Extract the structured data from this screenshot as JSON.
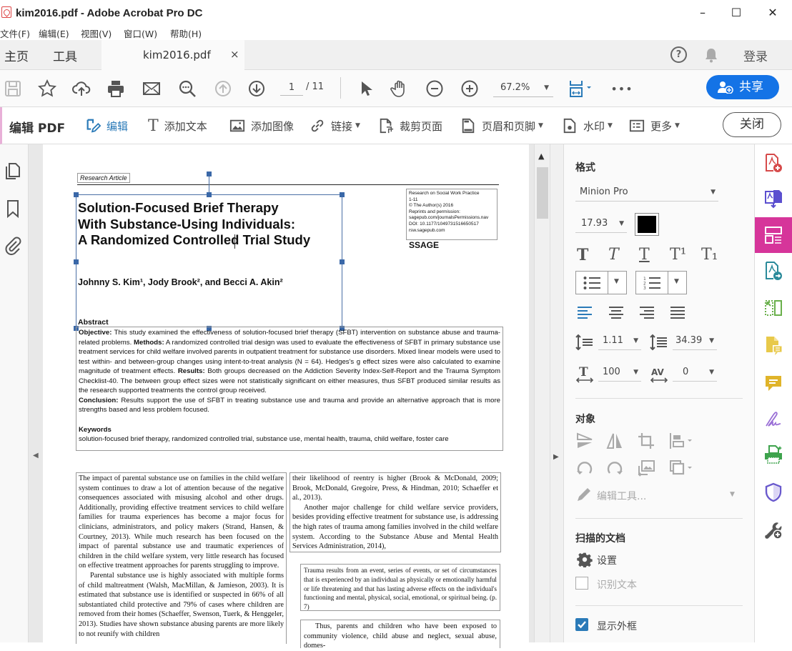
{
  "window": {
    "title": "kim2016.pdf - Adobe Acrobat Pro DC",
    "controls": {
      "minimize": "–",
      "maximize": "☐",
      "close": "✕"
    }
  },
  "menu": [
    "文件(F)",
    "编辑(E)",
    "视图(V)",
    "窗口(W)",
    "帮助(H)"
  ],
  "tabs": {
    "home": "主页",
    "tools": "工具",
    "document": "kim2016.pdf",
    "close_tab": "×",
    "help": "?",
    "login": "登录"
  },
  "toolbar": {
    "icons": [
      "save-icon",
      "star-icon",
      "cloud-upload-icon",
      "print-icon",
      "email-icon",
      "find-icon",
      "page-up-icon",
      "page-down-icon",
      "select-cursor-icon",
      "hand-icon",
      "zoom-out-icon",
      "zoom-in-icon",
      "fit-page-icon",
      "more-icon"
    ],
    "page_current": "1",
    "page_total": "/ 11",
    "zoom": "67.2%",
    "more": "•••",
    "share_label": "共享"
  },
  "edit_toolbar": {
    "title": "编辑 PDF",
    "edit": "编辑",
    "add_text": "添加文本",
    "add_image": "添加图像",
    "link": "链接",
    "crop": "裁剪页面",
    "header_footer": "页眉和页脚",
    "watermark": "水印",
    "more": "更多",
    "close": "关闭",
    "active_color": "#2a7ab8"
  },
  "format_panel": {
    "heading": "格式",
    "font": "Minion Pro",
    "font_size": "17.93",
    "text_color": "#000000",
    "style_buttons": [
      "T",
      "T",
      "T",
      "T¹",
      "T₁"
    ],
    "line_spacing": "1.11",
    "paragraph_spacing": "34.39",
    "horizontal_scale": "100",
    "char_spacing": "0",
    "objects_heading": "对象",
    "edit_tools": "编辑工具...",
    "scanned_heading": "扫描的文档",
    "settings": "设置",
    "recognize_text": "识别文本",
    "recognize_checked": false,
    "show_bounding": "显示外框",
    "show_bounding_checked": true
  },
  "right_rail": {
    "tools": [
      "create-pdf",
      "export-pdf",
      "edit-pdf",
      "combine-files",
      "organize-pages",
      "comment-file",
      "comment",
      "fill-sign",
      "scan",
      "protect",
      "more-tools"
    ],
    "active": "edit-pdf",
    "active_color": "#d6359a"
  },
  "document": {
    "label": "Research Article",
    "title_lines": [
      "Solution-Focused Brief Therapy",
      "With Substance-Using Individuals:",
      "A Randomized Controlled Trial Study"
    ],
    "authors": "Johnny S. Kim¹, Jody Brook², and Becci A. Akin²",
    "info_box": [
      "Research on Social Work Practice",
      "1-11",
      "© The Author(s) 2016",
      "Reprints and permission:",
      "sagepub.com/journalsPermissions.nav",
      "DOI: 10.1177/1049731516650517",
      "rsw.sagepub.com"
    ],
    "publisher": "SSAGE",
    "abstract_heading": "Abstract",
    "abstract": {
      "objective_label": "Objective:",
      "objective": " This study examined the effectiveness of solution-focused brief therapy (SFBT) intervention on substance abuse and trauma-related problems. ",
      "methods_label": "Methods:",
      "methods": " A randomized controlled trial design was used to evaluate the effectiveness of SFBT in primary substance use treatment services for child welfare involved parents in outpatient treatment for substance use disorders. Mixed linear models were used to test within- and between-group changes using intent-to-treat analysis (N = 64). Hedges's g effect sizes were also calculated to examine magnitude of treatment effects. ",
      "results_label": "Results:",
      "results": " Both groups decreased on the Addiction Severity Index-Self-Report and the Trauma Symptom Checklist-40. The between group effect sizes were not statistically significant on either measures, thus SFBT produced similar results as the research supported treatments the control group received. ",
      "conclusion_label": "Conclusion:",
      "conclusion": " Results support the use of SFBT in treating substance use and trauma and provide an alternative approach that is more strengths based and less problem focused."
    },
    "keywords_heading": "Keywords",
    "keywords": "solution-focused brief therapy, randomized controlled trial, substance use, mental health, trauma, child welfare, foster care",
    "col1_p1": "The impact of parental substance use on families in the child welfare system continues to draw a lot of attention because of the negative consequences associated with misusing alcohol and other drugs. Additionally, providing effective treatment services to child welfare families for trauma experiences has become a major focus for clinicians, administrators, and policy makers (Strand, Hansen, & Courtney, 2013). While much research has been focused on the impact of parental substance use and traumatic experiences of children in the child welfare system, very little research has focused on effective treatment approaches for parents struggling to improve.",
    "col1_p2": "Parental substance use is highly associated with multiple forms of child maltreatment (Walsh, MacMillan, & Jamieson, 2003). It is estimated that substance use is identified or suspected in 66% of all substantiated child protective and 79% of cases where children are removed from their homes (Schaeffer, Swenson, Tuerk, & Henggeler, 2013). Studies have shown substance abusing parents are more likely to not reunify with children",
    "col2_p1": "their likelihood of reentry is higher (Brook & McDonald, 2009; Brook, McDonald, Gregoire, Press, & Hindman, 2010; Schaeffer et al., 2013).",
    "col2_p2": "Another major challenge for child welfare service providers, besides providing effective treatment for substance use, is addressing the high rates of trauma among families involved in the child welfare system. According to the Substance Abuse and Mental Health Services Administration, 2014),",
    "quote": "Trauma results from an event, series of events, or set of circumstances that is experienced by an individual as physically or emotionally harmful or life threatening and that has lasting adverse effects on the individual's functioning and mental, physical, social, emotional, or spiritual being. (p. 7)",
    "col2_p3": "Thus, parents and children who have been exposed to community violence, child abuse and neglect, sexual abuse, domes-"
  }
}
